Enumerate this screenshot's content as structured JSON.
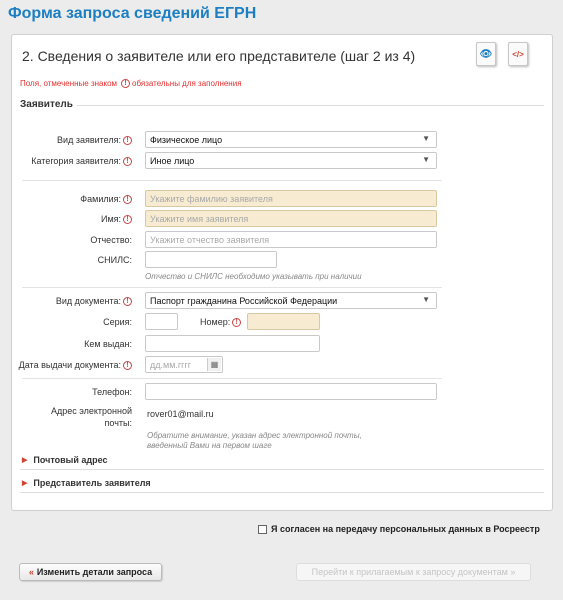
{
  "page": {
    "title": "Форма запроса сведений ЕГРН"
  },
  "step": {
    "title": "2. Сведения о заявителе или его представителе (шаг 2 из 4)"
  },
  "required_note": {
    "prefix": "Поля, отмеченные знаком",
    "suffix": "обязательны для заполнения"
  },
  "applicant": {
    "section_title": "Заявитель",
    "type": {
      "label": "Вид заявителя:",
      "value": "Физическое лицо"
    },
    "category": {
      "label": "Категория заявителя:",
      "value": "Иное лицо"
    },
    "last_name": {
      "label": "Фамилия:",
      "placeholder": "Укажите фамилию заявителя"
    },
    "first_name": {
      "label": "Имя:",
      "placeholder": "Укажите имя заявителя"
    },
    "patronymic": {
      "label": "Отчество:",
      "placeholder": "Укажите отчество заявителя"
    },
    "snils": {
      "label": "СНИЛС:",
      "value": ""
    },
    "snils_hint": "Отчество и СНИЛС необходимо указывать при наличии",
    "doc_type": {
      "label": "Вид документа:",
      "value": "Паспорт гражданина Российской Федерации"
    },
    "series": {
      "label": "Серия:",
      "value": ""
    },
    "number": {
      "label": "Номер:",
      "value": ""
    },
    "issued_by": {
      "label": "Кем выдан:",
      "value": ""
    },
    "issue_date": {
      "label": "Дата выдачи документа:",
      "placeholder": "дд.мм.гггг"
    },
    "phone": {
      "label": "Телефон:",
      "value": ""
    },
    "email": {
      "label_line1": "Адрес электронной",
      "label_line2": "почты:",
      "value": "rover01@mail.ru"
    },
    "email_hint_line1": "Обратите внимание, указан адрес электронной почты,",
    "email_hint_line2": "введенный Вами на первом шаге"
  },
  "sections": {
    "postal": "Почтовый адрес",
    "representative": "Представитель заявителя"
  },
  "consent": {
    "label": "Я согласен на передачу персональных данных в Росреестр",
    "checked": false
  },
  "buttons": {
    "back": "Изменить детали запроса",
    "back_arrow": "«",
    "next": "Перейти к прилагаемым к запросу документам",
    "next_arrow": "»"
  },
  "icons": {
    "req": "!",
    "caret": "▼",
    "tri": "▶",
    "calendar": "▦",
    "view": "👁",
    "code": "</>"
  },
  "colors": {
    "title": "#1d7ec0",
    "required": "#e03030",
    "highlight_field": "#f7ecd2"
  }
}
